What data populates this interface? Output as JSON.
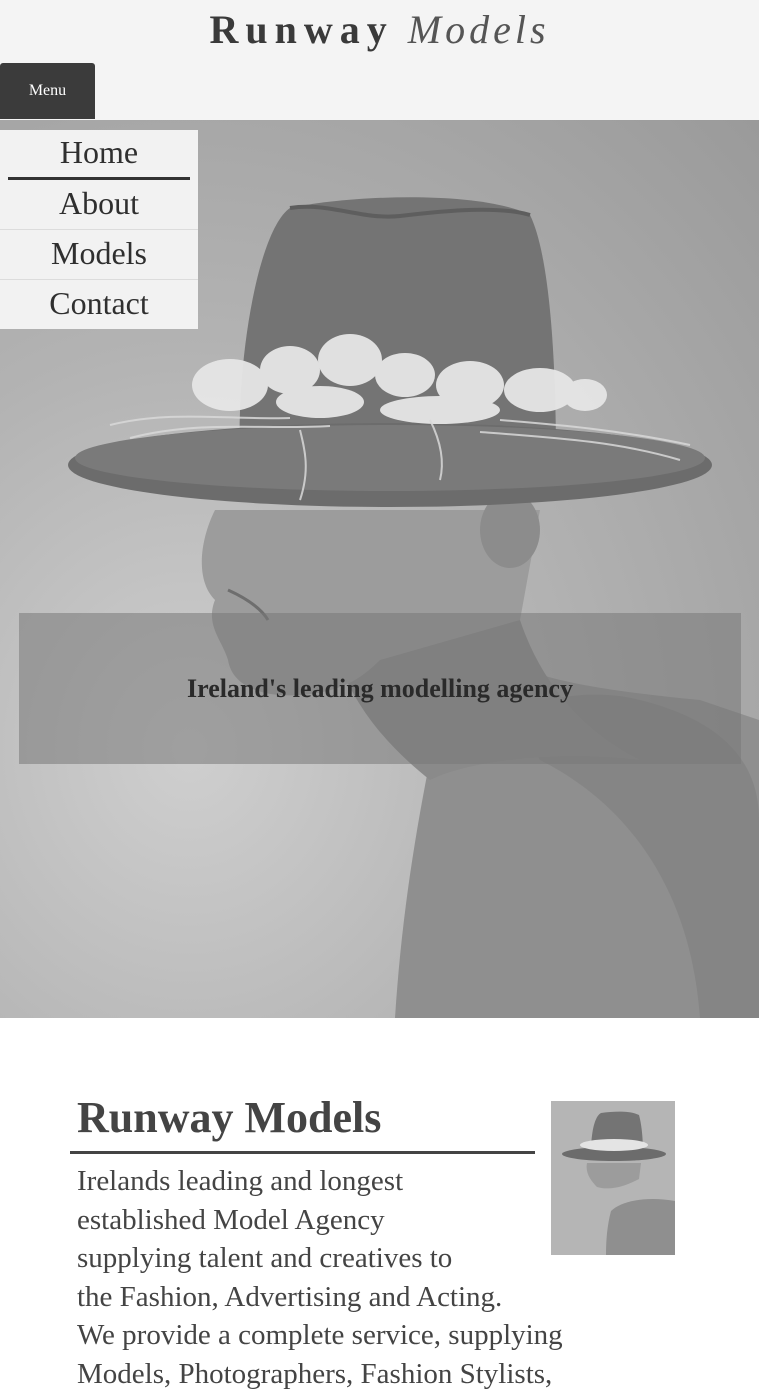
{
  "header": {
    "brand_part1": "Runway",
    "brand_part2": "Models",
    "menu_label": "Menu"
  },
  "nav": {
    "items": [
      {
        "label": "Home",
        "active": true
      },
      {
        "label": "About",
        "active": false
      },
      {
        "label": "Models",
        "active": false
      },
      {
        "label": "Contact",
        "active": false
      }
    ]
  },
  "hero": {
    "tagline": "Ireland's leading modelling agency"
  },
  "about": {
    "title": "Runway Models",
    "lines": [
      "Irelands leading and longest",
      "established Model Agency",
      "supplying talent and creatives to",
      "the Fashion, Advertising and Acting.",
      "We provide a complete service, supplying",
      "Models, Photographers, Fashion Stylists,"
    ]
  },
  "colors": {
    "header_bg": "#f4f4f4",
    "menu_button_bg": "#3b3b3b",
    "text_dark": "#333333"
  }
}
